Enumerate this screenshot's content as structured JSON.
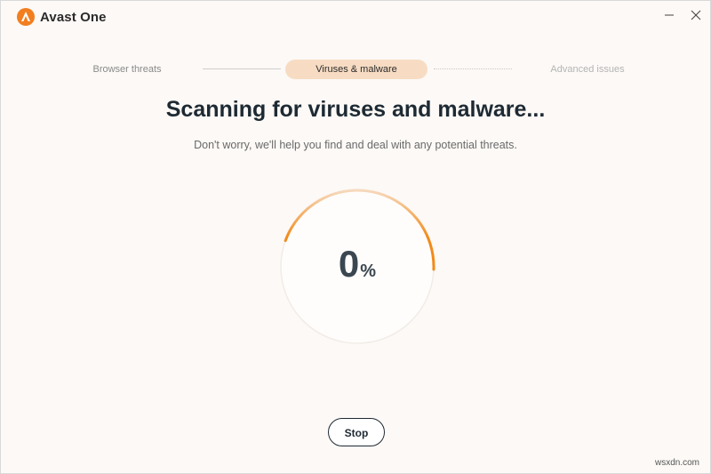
{
  "app": {
    "name": "Avast One"
  },
  "window_controls": {
    "minimize_icon": "minimize-icon",
    "close_icon": "close-icon"
  },
  "stepper": {
    "steps": [
      {
        "label": "Browser threats",
        "state": "done"
      },
      {
        "label": "Viruses & malware",
        "state": "active"
      },
      {
        "label": "Advanced issues",
        "state": "pending"
      }
    ]
  },
  "main": {
    "title": "Scanning for viruses and malware...",
    "subtitle": "Don't worry, we'll help you find and deal with any potential threats."
  },
  "progress": {
    "value": "0",
    "unit": "%",
    "ring_fraction": 0.45,
    "accent": "#f28a1a",
    "track": "#f1ece7"
  },
  "actions": {
    "stop_label": "Stop"
  },
  "watermark": {
    "text": "wsxdn.com"
  }
}
